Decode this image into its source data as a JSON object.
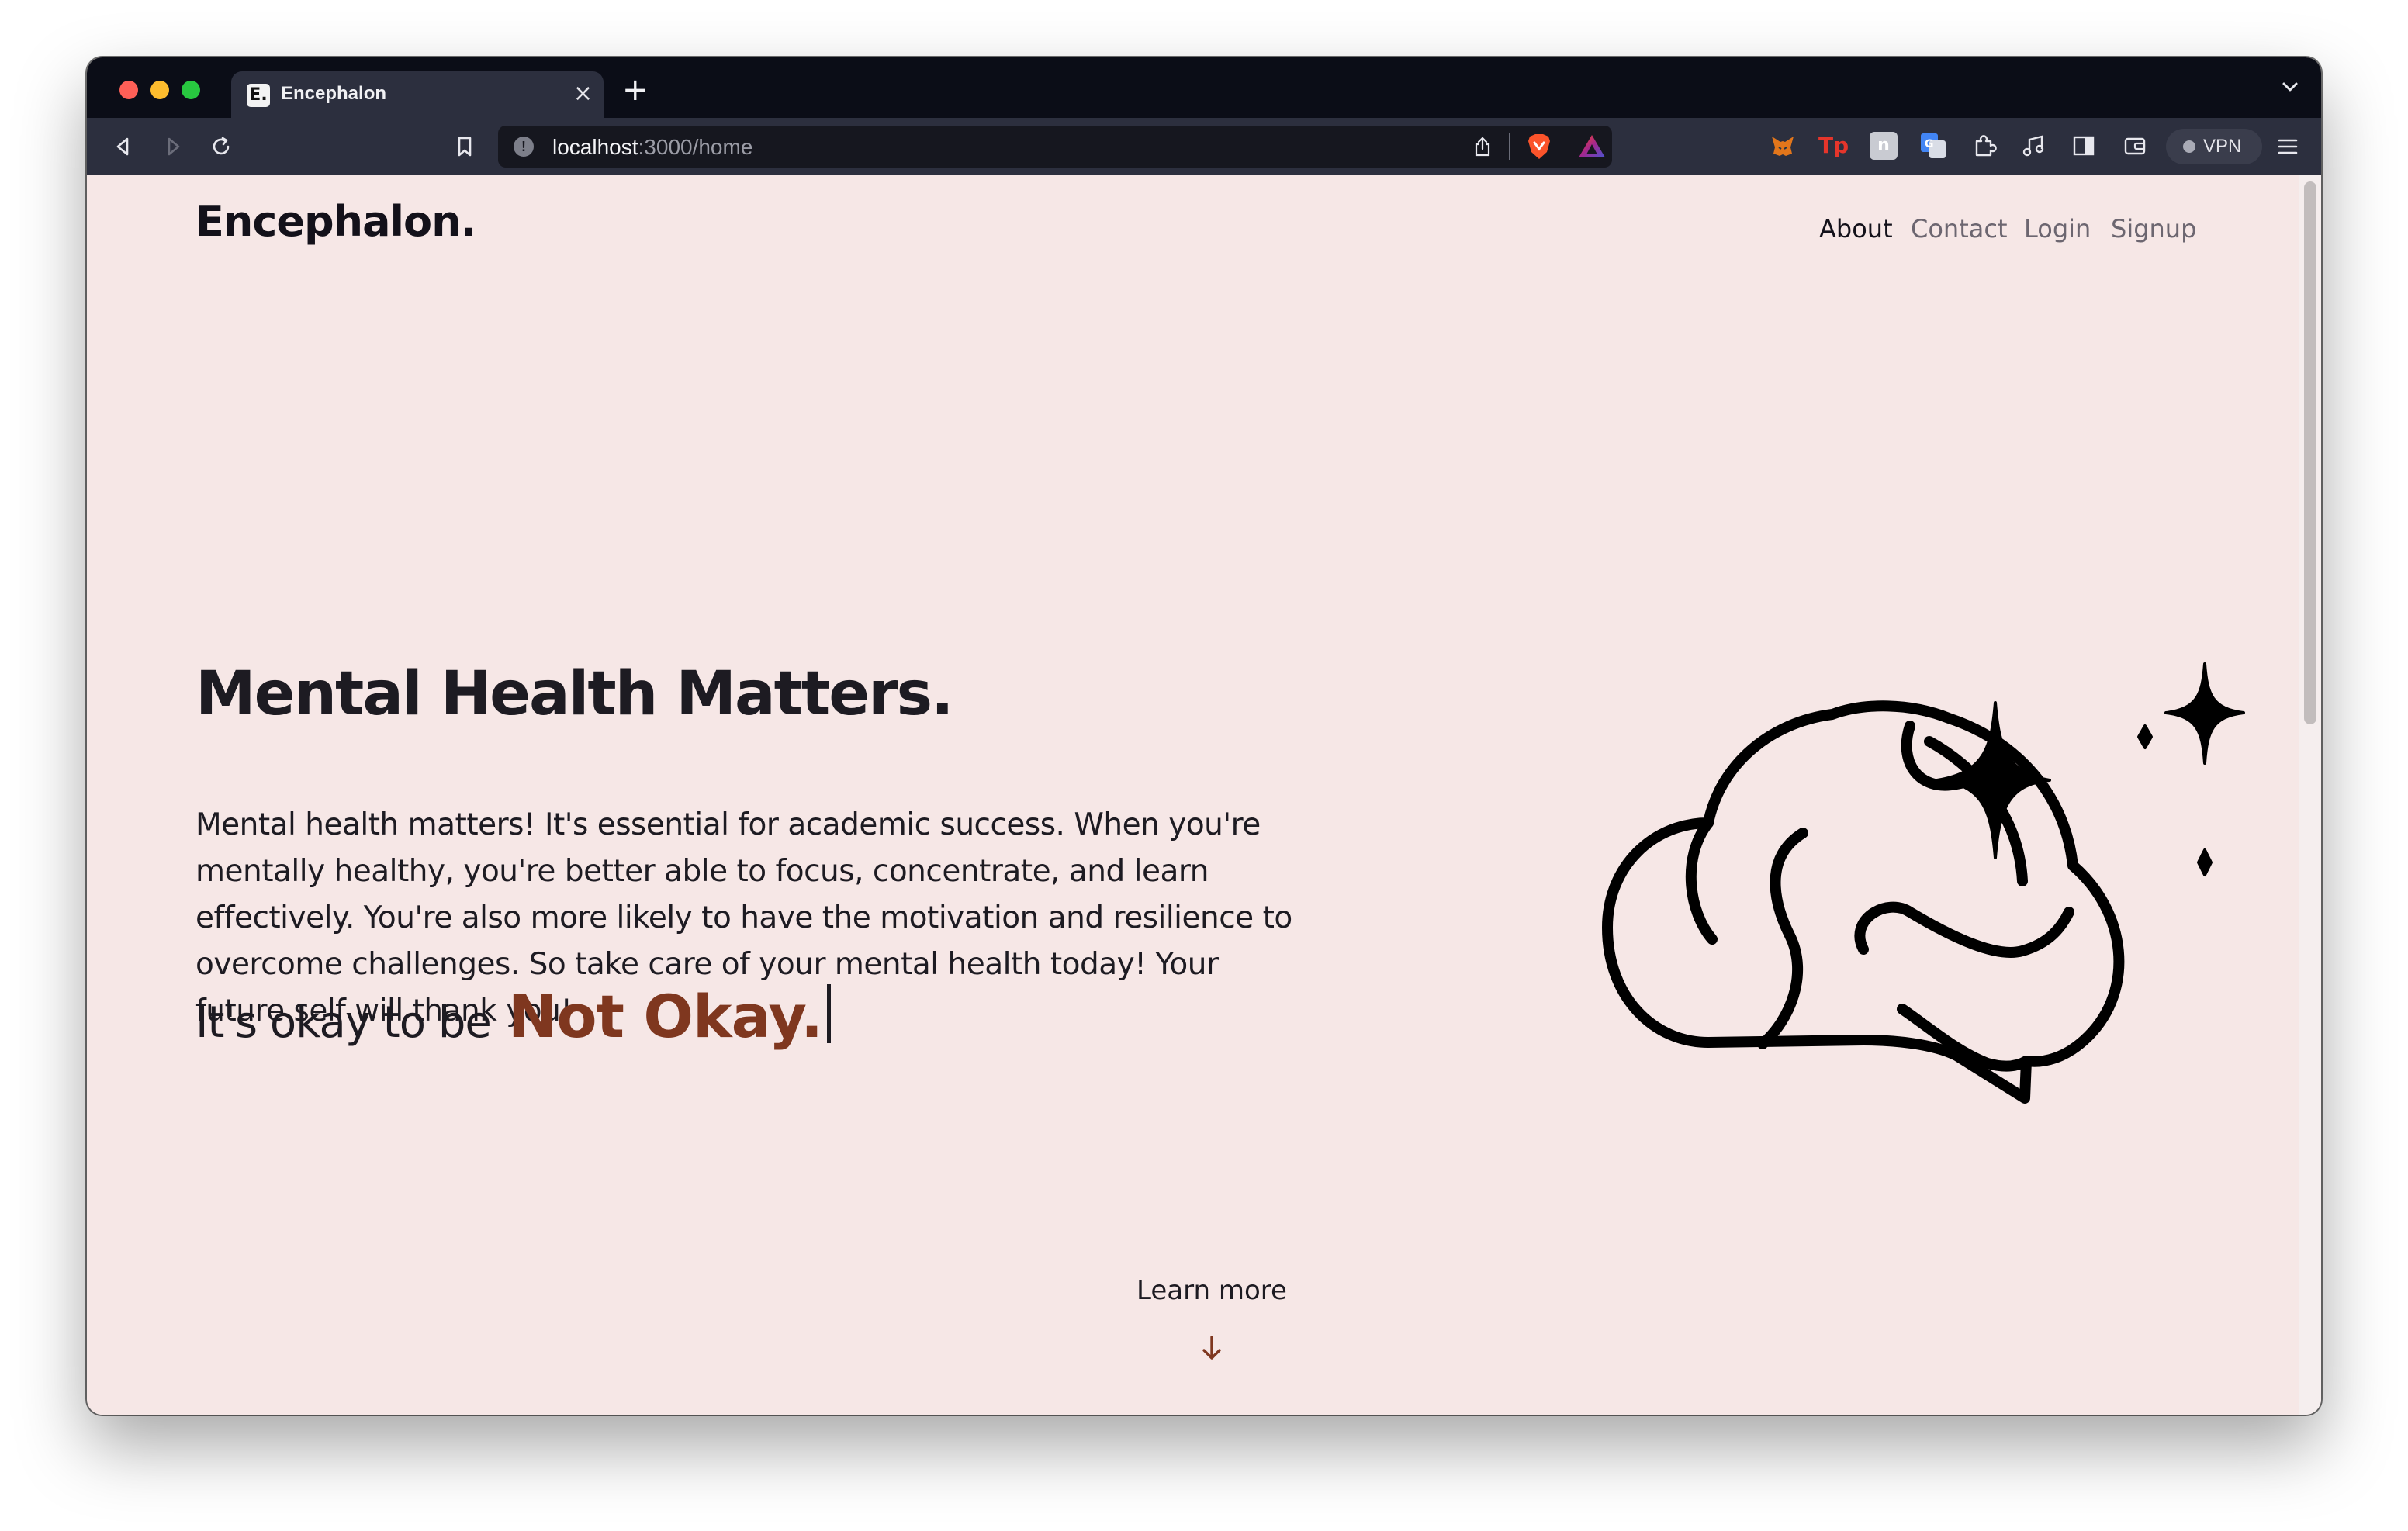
{
  "browser": {
    "tab": {
      "title": "Encephalon",
      "favicon": "E."
    },
    "new_tab_label": "+",
    "close_tab_label": "×",
    "url": {
      "host": "localhost",
      "path": ":3000/home"
    },
    "vpn_label": "VPN"
  },
  "site": {
    "logo": "Encephalon.",
    "nav": {
      "about": "About",
      "contact": "Contact",
      "login": "Login",
      "signup": "Signup"
    }
  },
  "hero": {
    "title": "Mental Health Matters.",
    "body": "Mental health matters! It's essential for academic success. When you're mentally healthy, you're better able to focus, concentrate, and learn effectively. You're also more likely to have the motivation and resilience to overcome challenges. So take care of your mental health today! Your future self will thank you!",
    "tagline_prefix": "It's okay to be",
    "tagline_accent": "Not Okay.",
    "illustration": "brain-with-sparkles-icon"
  },
  "footer_cta": {
    "label": "Learn more",
    "icon": "arrow-down-icon"
  },
  "colors": {
    "page_background": "#f6e7e6",
    "accent": "#7f371f",
    "text": "#1d1b22",
    "browser_chrome": "#2c2f3e",
    "tab_strip": "#0b0d17"
  }
}
